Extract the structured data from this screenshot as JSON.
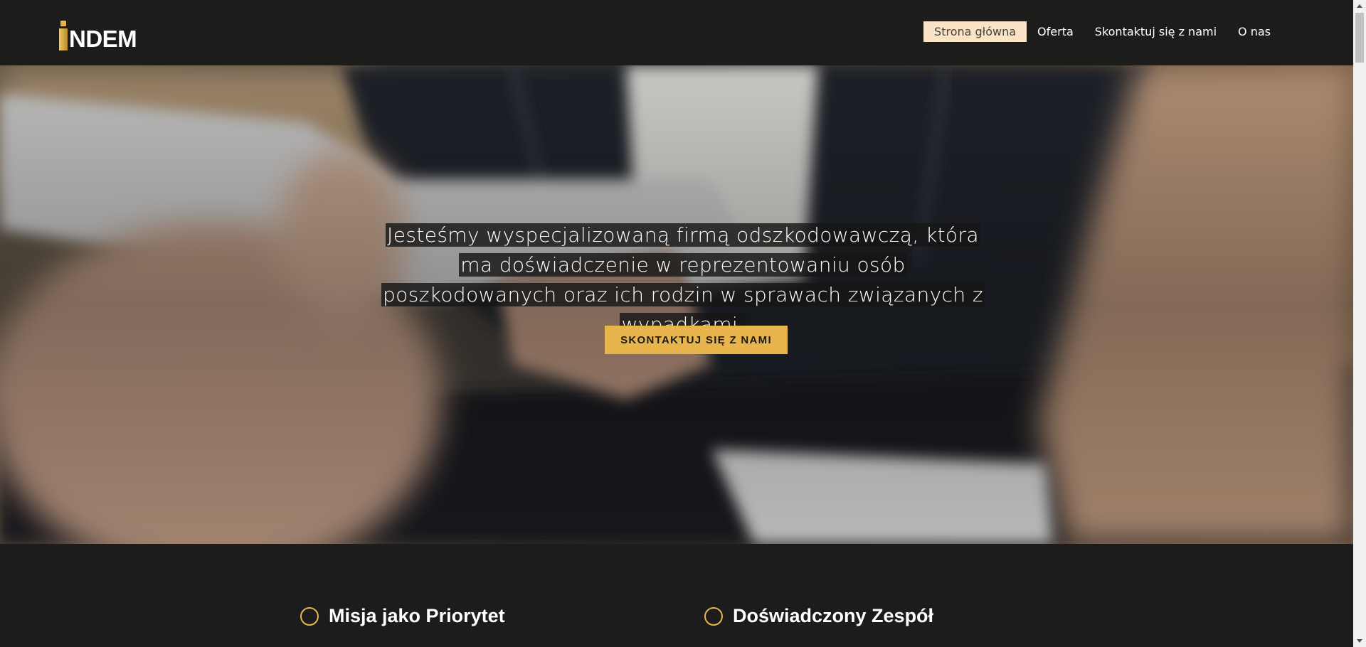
{
  "header": {
    "logo_text": "NDEM",
    "logo_icon": "pillar-i-logo-mark",
    "nav": [
      {
        "label": "Strona główna",
        "active": true
      },
      {
        "label": "Oferta",
        "active": false
      },
      {
        "label": "Skontaktuj się z nami",
        "active": false
      },
      {
        "label": "O nas",
        "active": false
      }
    ]
  },
  "hero": {
    "headline": "Jesteśmy wyspecjalizowaną firmą odszkodowawczą, która ma doświadczenie w reprezentowaniu osób poszkodowanych oraz ich rodzin w sprawach związanych z wypadkami.",
    "cta_label": "SKONTAKTUJ SIĘ Z NAMI",
    "background_image": "blurred photo of people exchanging documents at a table"
  },
  "features": [
    {
      "title": "Misja jako Priorytet",
      "icon": "circle-outline-icon"
    },
    {
      "title": "Doświadczony Zespół",
      "icon": "circle-outline-icon"
    }
  ],
  "colors": {
    "accent": "#e8b44c",
    "nav_active_bg": "#fbe3c5",
    "header_bg": "#1c1c1b",
    "page_bg": "#1c1c1c"
  }
}
